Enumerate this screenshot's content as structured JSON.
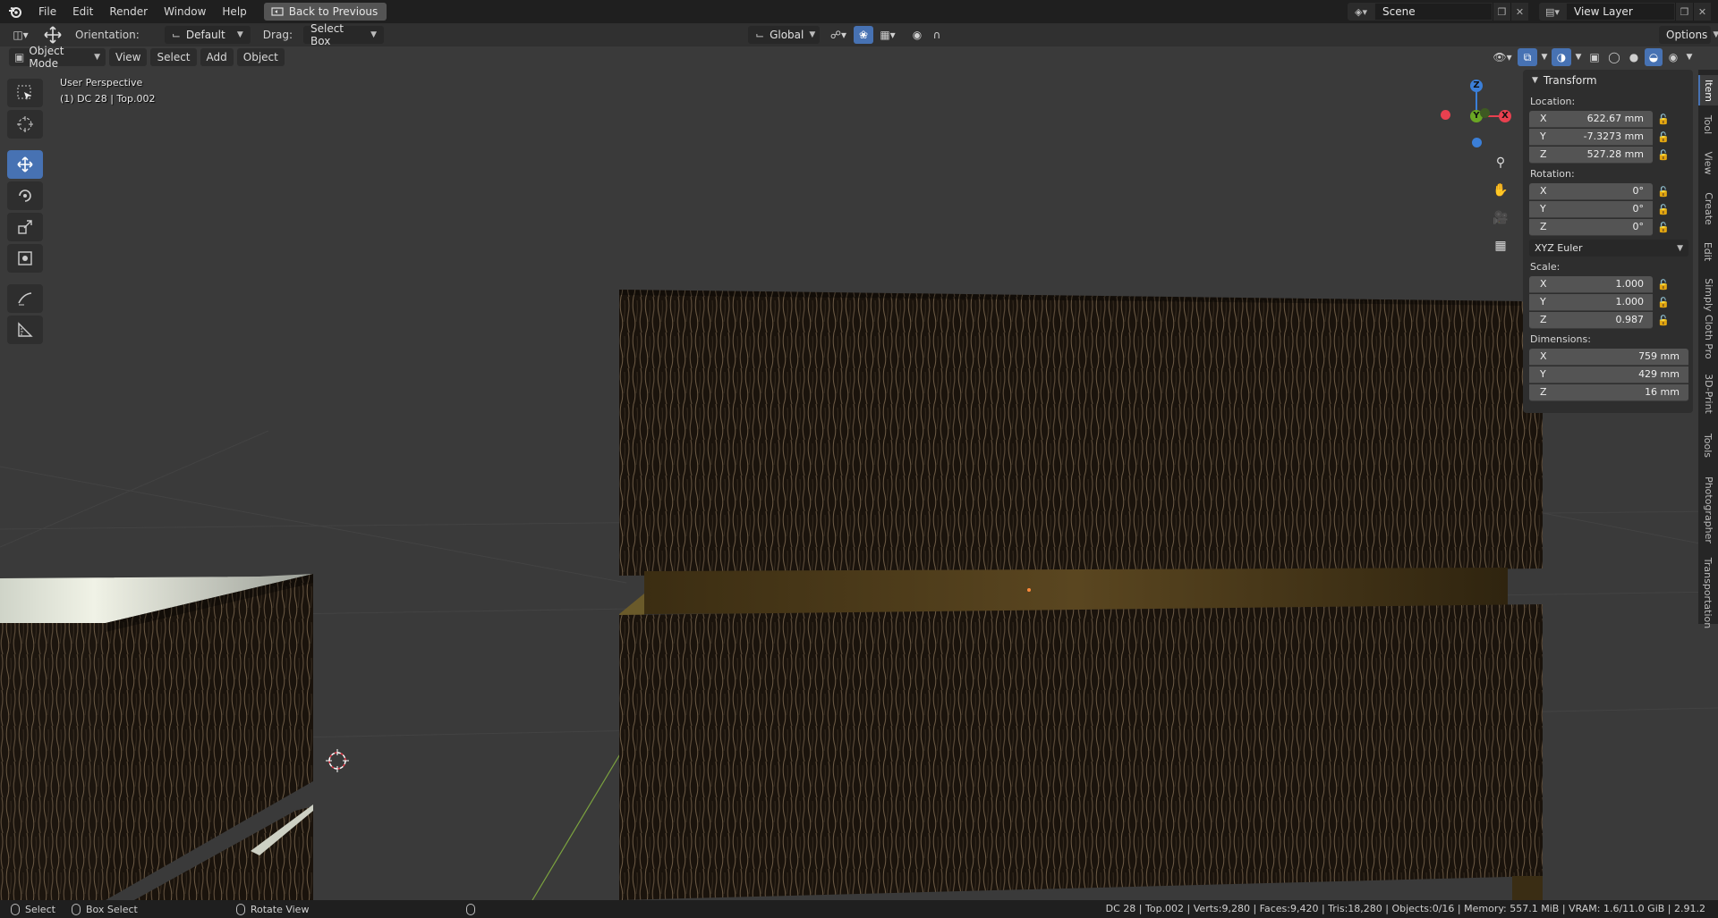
{
  "topbar": {
    "menus": [
      "File",
      "Edit",
      "Render",
      "Window",
      "Help"
    ],
    "back_label": "Back to Previous",
    "scene": "Scene",
    "view_layer": "View Layer"
  },
  "header": {
    "orientation_label": "Orientation:",
    "orientation_value": "Default",
    "drag_label": "Drag:",
    "drag_value": "Select Box",
    "transform_orientation": "Global",
    "options_label": "Options"
  },
  "viewport_header": {
    "mode": "Object Mode",
    "menus": [
      "View",
      "Select",
      "Add",
      "Object"
    ]
  },
  "overlay": {
    "perspective": "User Perspective",
    "object_info": "(1) DC 28 | Top.002"
  },
  "gizmo": {
    "z": "Z",
    "y": "Y",
    "x": "X"
  },
  "npanel": {
    "title": "Transform",
    "location_label": "Location:",
    "location": [
      {
        "axis": "X",
        "value": "622.67 mm"
      },
      {
        "axis": "Y",
        "value": "-7.3273 mm"
      },
      {
        "axis": "Z",
        "value": "527.28 mm"
      }
    ],
    "rotation_label": "Rotation:",
    "rotation": [
      {
        "axis": "X",
        "value": "0°"
      },
      {
        "axis": "Y",
        "value": "0°"
      },
      {
        "axis": "Z",
        "value": "0°"
      }
    ],
    "rotation_mode": "XYZ Euler",
    "scale_label": "Scale:",
    "scale": [
      {
        "axis": "X",
        "value": "1.000"
      },
      {
        "axis": "Y",
        "value": "1.000"
      },
      {
        "axis": "Z",
        "value": "0.987"
      }
    ],
    "dimensions_label": "Dimensions:",
    "dimensions": [
      {
        "axis": "X",
        "value": "759 mm"
      },
      {
        "axis": "Y",
        "value": "429 mm"
      },
      {
        "axis": "Z",
        "value": "16 mm"
      }
    ]
  },
  "side_tabs": [
    "Item",
    "Tool",
    "View",
    "Create",
    "Edit",
    "Simply Cloth Pro",
    "3D-Print",
    "Tools",
    "Photographer",
    "Transportation"
  ],
  "statusbar": {
    "select": "Select",
    "box_select": "Box Select",
    "rotate_view": "Rotate View",
    "stats": "DC 28 | Top.002 | Verts:9,280 | Faces:9,420 | Tris:18,280 | Objects:0/16 | Memory: 557.1 MiB | VRAM: 1.6/11.0 GiB | 2.91.2"
  },
  "colors": {
    "accent": "#4772b3",
    "gizmo_x": "#e8404f",
    "gizmo_y": "#6aa624",
    "gizmo_z": "#3b7fd8"
  }
}
